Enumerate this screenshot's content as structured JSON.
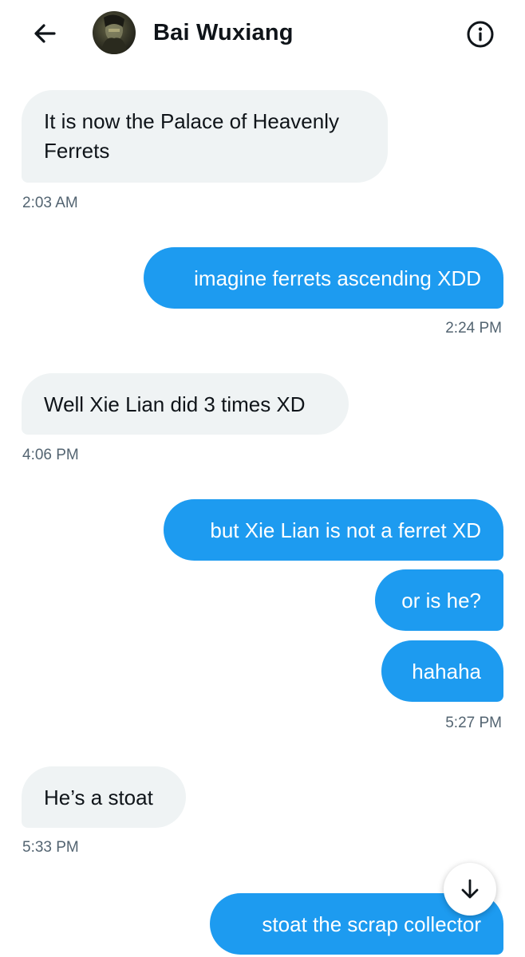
{
  "header": {
    "title": "Bai Wuxiang",
    "back_icon": "arrow-left-icon",
    "info_icon": "info-icon"
  },
  "messages": [
    {
      "direction": "in",
      "text": "It is now the Palace of Heavenly Ferrets",
      "time": "2:03 AM"
    },
    {
      "direction": "out",
      "text": "imagine ferrets ascending XDD",
      "time": "2:24 PM"
    },
    {
      "direction": "in",
      "text": "Well Xie Lian did 3 times XD",
      "time": "4:06 PM"
    },
    {
      "direction": "out",
      "text": "but Xie Lian is not a ferret XD",
      "time": ""
    },
    {
      "direction": "out",
      "text": "or is he?",
      "time": ""
    },
    {
      "direction": "out",
      "text": "hahaha",
      "time": "5:27 PM"
    },
    {
      "direction": "in",
      "text": "He’s a stoat",
      "time": "5:33 PM"
    },
    {
      "direction": "out",
      "text": "stoat the scrap collector",
      "time": ""
    }
  ],
  "scroll_button": {
    "icon": "arrow-down-icon"
  },
  "colors": {
    "outgoing_bubble": "#1d9bf0",
    "incoming_bubble": "#eff3f4",
    "timestamp": "#536471",
    "text": "#0f1419"
  }
}
